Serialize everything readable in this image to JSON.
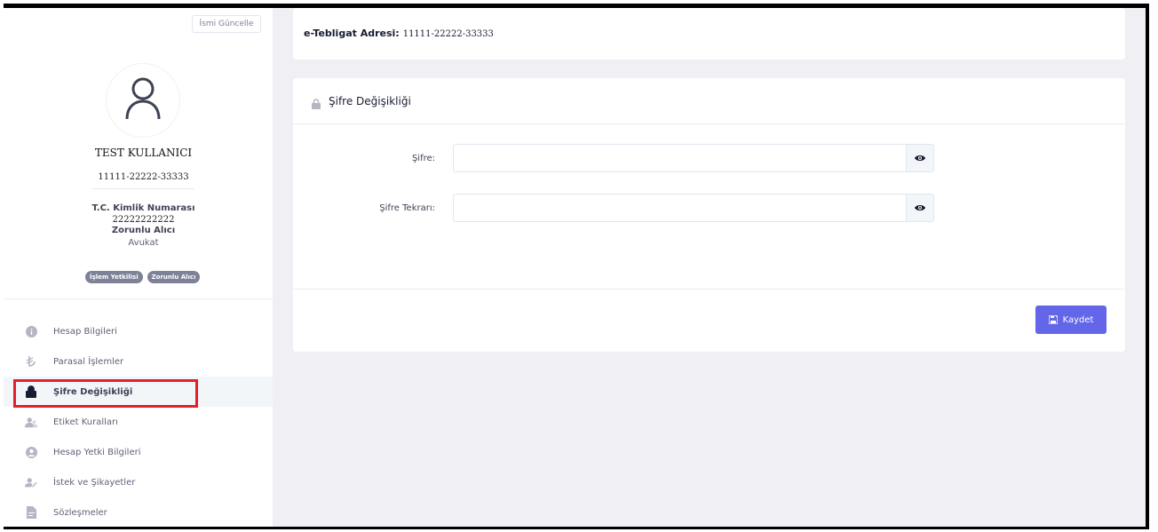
{
  "sidebar": {
    "rename_button": "İsmi Güncelle",
    "user": {
      "name": "TEST KULLANICI",
      "id": "11111-22222-33333",
      "kimlik_label": "T.C. Kimlik Numarası",
      "kimlik_value": "22222222222",
      "role": "Zorunlu Alıcı",
      "title": "Avukat"
    },
    "badges": [
      "İşlem Yetkilisi",
      "Zorunlu Alıcı"
    ],
    "menu": [
      {
        "label": "Hesap Bilgileri",
        "icon": "info-icon"
      },
      {
        "label": "Parasal İşlemler",
        "icon": "lira-icon"
      },
      {
        "label": "Şifre Değişikliği",
        "icon": "lock-icon",
        "active": true
      },
      {
        "label": "Etiket Kuralları",
        "icon": "users-icon"
      },
      {
        "label": "Hesap Yetki Bilgileri",
        "icon": "user-circle-icon"
      },
      {
        "label": "İstek ve Şikayetler",
        "icon": "user-edit-icon"
      },
      {
        "label": "Sözleşmeler",
        "icon": "document-icon"
      }
    ]
  },
  "top_card": {
    "label": "e-Tebligat Adresi:",
    "value": "11111-22222-33333"
  },
  "password_card": {
    "title": "Şifre Değişikliği",
    "fields": [
      {
        "label": "Şifre:",
        "value": ""
      },
      {
        "label": "Şifre Tekrarı:",
        "value": ""
      }
    ],
    "save_label": "Kaydet"
  },
  "colors": {
    "accent": "#6366e8",
    "highlight": "#e3202b",
    "background": "#efeff4"
  }
}
